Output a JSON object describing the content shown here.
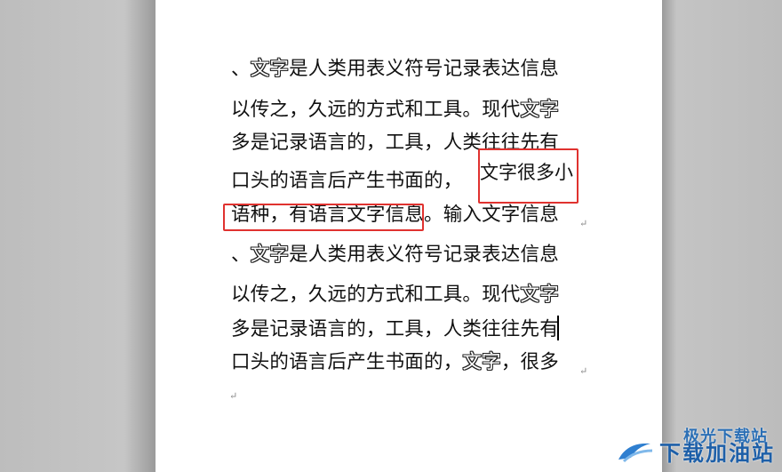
{
  "document": {
    "para1": {
      "line1": {
        "a": "、",
        "b": "文字",
        "c": "是人类用表义符号记录表达信息"
      },
      "line2": {
        "a": "以传之，久远的方式和工具。现代",
        "b": "文字"
      },
      "line3": "多是记录语言的，工具，人类往往先有",
      "line4": "口头的语言后产生书面的，",
      "line5": "语种，有语言文字信息。输入文字信息"
    },
    "para2": {
      "line1": {
        "a": "、",
        "b": "文字",
        "c": "是人类用表义符号记录表达信息"
      },
      "line2": {
        "a": "以传之，久远的方式和工具。现代",
        "b": "文字"
      },
      "line3": {
        "a": "多是记录语言的，工具，人类往往先",
        "b": "有"
      },
      "line4": {
        "a": "口头的语言后产生书面的，",
        "b": "文字",
        "c": "，很多"
      }
    },
    "text_box": "文字很多小",
    "paragraph_mark": "↵"
  },
  "watermark": {
    "top": "极光下载站",
    "bottom": "下载加油站"
  },
  "colors": {
    "highlight_box": "#e0322f",
    "page": "#ffffff",
    "workspace": "#bcbcbc"
  }
}
